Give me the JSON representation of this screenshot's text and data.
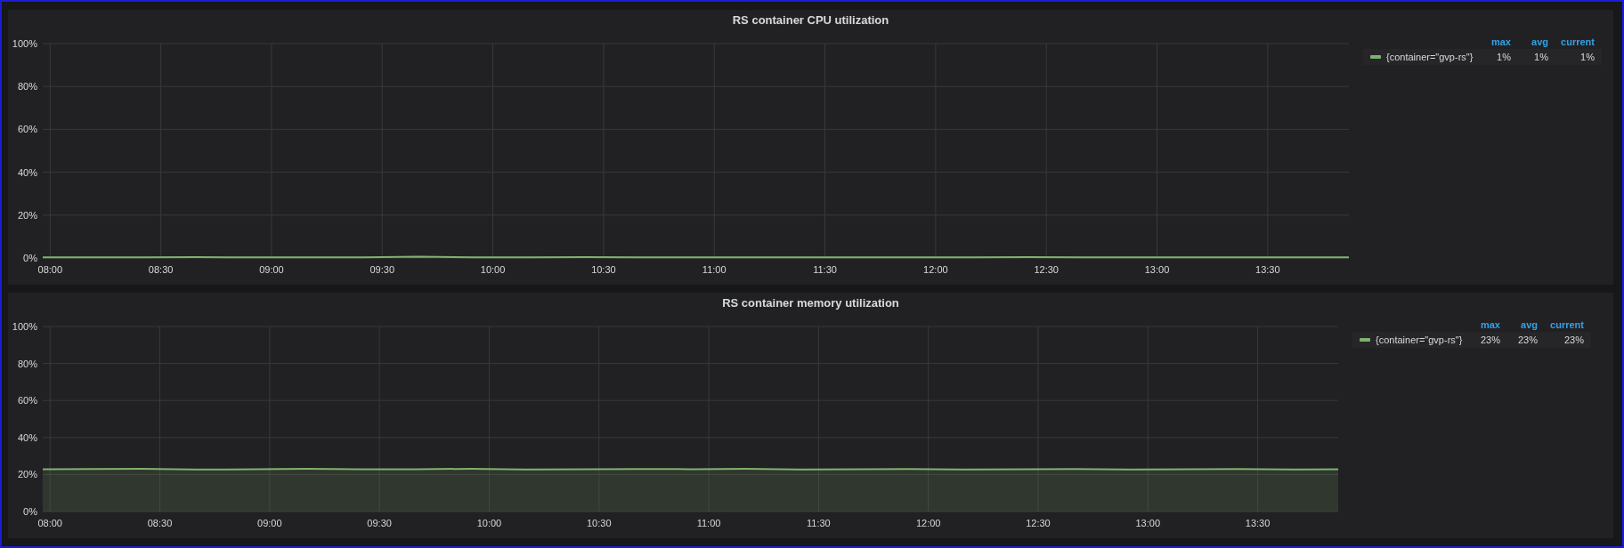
{
  "panels": [
    {
      "title": "RS container CPU utilization",
      "legend": {
        "columns": [
          "max",
          "avg",
          "current"
        ],
        "rows": [
          {
            "values": [
              "1%",
              "1%",
              "1%"
            ]
          }
        ]
      },
      "chart_data": {
        "type": "line",
        "grid": true,
        "x": [
          478,
          490,
          505,
          520,
          535,
          550,
          565,
          580,
          595,
          610,
          625,
          640,
          655,
          670,
          685,
          700,
          715,
          730,
          745,
          760,
          775,
          790,
          805,
          820,
          832
        ],
        "xlim": [
          478,
          832
        ],
        "ylim": [
          0,
          100
        ],
        "xticks": [
          {
            "value": 480,
            "label": "08:00"
          },
          {
            "value": 510,
            "label": "08:30"
          },
          {
            "value": 540,
            "label": "09:00"
          },
          {
            "value": 570,
            "label": "09:30"
          },
          {
            "value": 600,
            "label": "10:00"
          },
          {
            "value": 630,
            "label": "10:30"
          },
          {
            "value": 660,
            "label": "11:00"
          },
          {
            "value": 690,
            "label": "11:30"
          },
          {
            "value": 720,
            "label": "12:00"
          },
          {
            "value": 750,
            "label": "12:30"
          },
          {
            "value": 780,
            "label": "13:00"
          },
          {
            "value": 810,
            "label": "13:30"
          }
        ],
        "yticks": [
          {
            "value": 0,
            "label": "0%"
          },
          {
            "value": 20,
            "label": "20%"
          },
          {
            "value": 40,
            "label": "40%"
          },
          {
            "value": 60,
            "label": "60%"
          },
          {
            "value": 80,
            "label": "80%"
          },
          {
            "value": 100,
            "label": "100%"
          }
        ],
        "series": [
          {
            "name": "{container=\"gvp-rs\"}",
            "color": "#7eb26d",
            "values": [
              0.3,
              0.3,
              0.3,
              0.4,
              0.3,
              0.3,
              0.3,
              0.6,
              0.3,
              0.3,
              0.4,
              0.3,
              0.3,
              0.3,
              0.3,
              0.3,
              0.3,
              0.3,
              0.4,
              0.3,
              0.3,
              0.3,
              0.3,
              0.3,
              0.3
            ]
          }
        ]
      }
    },
    {
      "title": "RS container memory utilization",
      "legend": {
        "columns": [
          "max",
          "avg",
          "current"
        ],
        "rows": [
          {
            "values": [
              "23%",
              "23%",
              "23%"
            ]
          }
        ]
      },
      "chart_data": {
        "type": "area",
        "grid": true,
        "x": [
          478,
          490,
          505,
          520,
          535,
          550,
          565,
          580,
          595,
          610,
          625,
          640,
          655,
          670,
          685,
          700,
          715,
          730,
          745,
          760,
          775,
          790,
          805,
          820,
          832
        ],
        "xlim": [
          478,
          832
        ],
        "ylim": [
          0,
          100
        ],
        "xticks": [
          {
            "value": 480,
            "label": "08:00"
          },
          {
            "value": 510,
            "label": "08:30"
          },
          {
            "value": 540,
            "label": "09:00"
          },
          {
            "value": 570,
            "label": "09:30"
          },
          {
            "value": 600,
            "label": "10:00"
          },
          {
            "value": 630,
            "label": "10:30"
          },
          {
            "value": 660,
            "label": "11:00"
          },
          {
            "value": 690,
            "label": "11:30"
          },
          {
            "value": 720,
            "label": "12:00"
          },
          {
            "value": 750,
            "label": "12:30"
          },
          {
            "value": 780,
            "label": "13:00"
          },
          {
            "value": 810,
            "label": "13:30"
          }
        ],
        "yticks": [
          {
            "value": 0,
            "label": "0%"
          },
          {
            "value": 20,
            "label": "20%"
          },
          {
            "value": 40,
            "label": "40%"
          },
          {
            "value": 60,
            "label": "60%"
          },
          {
            "value": 80,
            "label": "80%"
          },
          {
            "value": 100,
            "label": "100%"
          }
        ],
        "series": [
          {
            "name": "{container=\"gvp-rs\"}",
            "color": "#7eb26d",
            "values": [
              22.8,
              23,
              23.1,
              22.7,
              22.8,
              23.1,
              22.8,
              22.9,
              23.1,
              22.7,
              22.8,
              23,
              22.9,
              23.1,
              22.7,
              22.8,
              23,
              22.7,
              22.9,
              23,
              22.7,
              22.8,
              23,
              22.7,
              22.8
            ]
          }
        ]
      }
    }
  ]
}
